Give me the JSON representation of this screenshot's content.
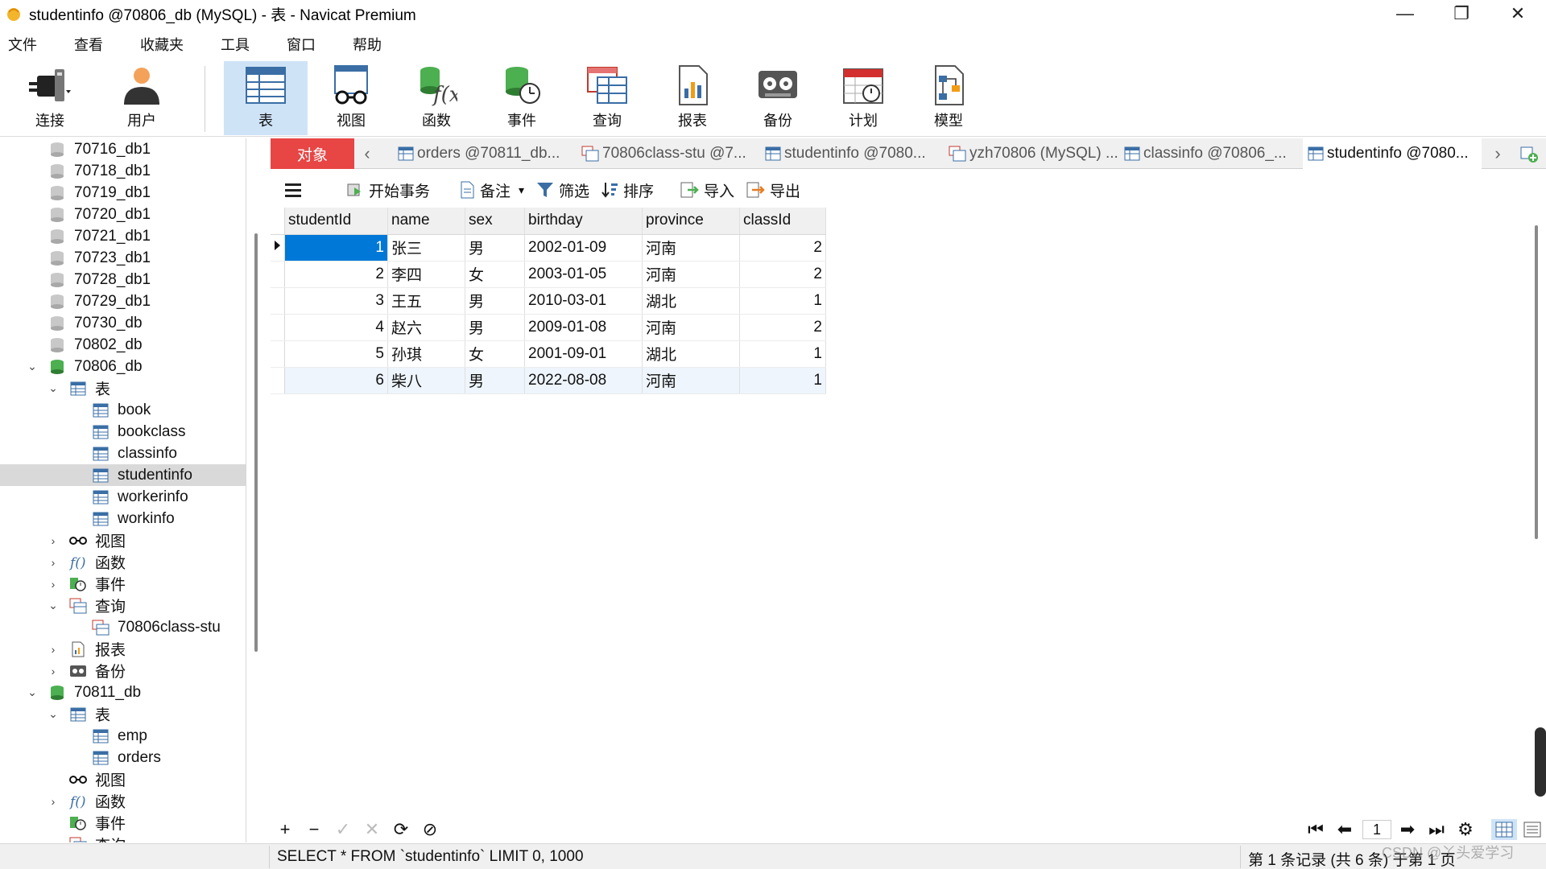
{
  "window": {
    "title": "studentinfo @70806_db (MySQL) - 表 - Navicat Premium",
    "minimize_glyph": "—",
    "restore_glyph": "❐",
    "close_glyph": "✕"
  },
  "menu": [
    "文件",
    "查看",
    "收藏夹",
    "工具",
    "窗口",
    "帮助"
  ],
  "toolbar": {
    "connect": "连接",
    "user": "用户",
    "table": "表",
    "view": "视图",
    "function": "函数",
    "event": "事件",
    "query": "查询",
    "report": "报表",
    "backup": "备份",
    "schedule": "计划",
    "model": "模型"
  },
  "tree": {
    "db_70716": "70716_db1",
    "db_70718": "70718_db1",
    "db_70719": "70719_db1",
    "db_70720": "70720_db1",
    "db_70721": "70721_db1",
    "db_70723": "70723_db1",
    "db_70728": "70728_db1",
    "db_70729": "70729_db1",
    "db_70730": "70730_db",
    "db_70802": "70802_db",
    "db_70806": "70806_db",
    "tables_label": "表",
    "t_book": "book",
    "t_bookclass": "bookclass",
    "t_classinfo": "classinfo",
    "t_studentinfo": "studentinfo",
    "t_workerinfo": "workerinfo",
    "t_workinfo": "workinfo",
    "views_label": "视图",
    "functions_label": "函数",
    "events_label": "事件",
    "queries_label": "查询",
    "q_classstu": "70806class-stu",
    "reports_label": "报表",
    "backups_label": "备份",
    "db_70811": "70811_db",
    "tables2_label": "表",
    "t_emp": "emp",
    "t_orders": "orders",
    "views2_label": "视图",
    "functions2_label": "函数",
    "events2_label": "事件",
    "queries2_label": "查询"
  },
  "tabs": {
    "objects": "对象",
    "t1": "orders @70811_db...",
    "t2": "70806class-stu @7...",
    "t3": "studentinfo @7080...",
    "t4": "yzh70806 (MySQL) ...",
    "t5": "classinfo @70806_...",
    "t6": "studentinfo @7080..."
  },
  "subtoolbar": {
    "begin_tx": "开始事务",
    "memo": "备注",
    "filter": "筛选",
    "sort": "排序",
    "import": "导入",
    "export": "导出"
  },
  "grid": {
    "columns": [
      "studentId",
      "name",
      "sex",
      "birthday",
      "province",
      "classId"
    ],
    "rows": [
      [
        "1",
        "张三",
        "男",
        "2002-01-09",
        "河南",
        "2"
      ],
      [
        "2",
        "李四",
        "女",
        "2003-01-05",
        "河南",
        "2"
      ],
      [
        "3",
        "王五",
        "男",
        "2010-03-01",
        "湖北",
        "1"
      ],
      [
        "4",
        "赵六",
        "男",
        "2009-01-08",
        "河南",
        "2"
      ],
      [
        "5",
        "孙琪",
        "女",
        "2001-09-01",
        "湖北",
        "1"
      ],
      [
        "6",
        "柴八",
        "男",
        "2022-08-08",
        "河南",
        "1"
      ]
    ]
  },
  "actions": {
    "add": "+",
    "remove": "−",
    "apply": "✓",
    "discard": "✕",
    "refresh": "⟳",
    "stop": "⊘",
    "first": "⏮",
    "prev": "⬅",
    "page": "1",
    "next": "➡",
    "last": "⏭",
    "settings": "⚙"
  },
  "status": {
    "sql": "SELECT * FROM `studentinfo` LIMIT 0, 1000",
    "records": "第 1 条记录 (共 6 条) 于第 1 页",
    "watermark": "CSDN @丫头爱学习"
  },
  "colors": {
    "accent": "#0078d7",
    "objects_tab": "#e84545",
    "active_tool": "#cfe3f7"
  }
}
